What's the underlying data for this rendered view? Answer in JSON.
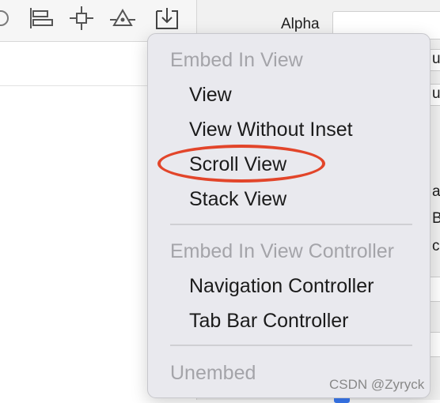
{
  "toolbar": {
    "icons": [
      "circle-partial-icon",
      "align-left-icon",
      "align-center-icon",
      "resolve-constraints-icon",
      "embed-in-icon"
    ]
  },
  "inspector": {
    "alpha_label": "Alpha",
    "peek_letters": [
      "u",
      "u",
      "a",
      "B",
      "c"
    ]
  },
  "menu": {
    "sections": [
      {
        "header": "Embed In View",
        "items": [
          "View",
          "View Without Inset",
          "Scroll View",
          "Stack View"
        ]
      },
      {
        "header": "Embed In View Controller",
        "items": [
          "Navigation Controller",
          "Tab Bar Controller"
        ]
      },
      {
        "header": "Unembed",
        "items": []
      }
    ],
    "highlighted_item": "Scroll View",
    "highlight_color": "#e2452a"
  },
  "watermark": "CSDN @Zyryck"
}
